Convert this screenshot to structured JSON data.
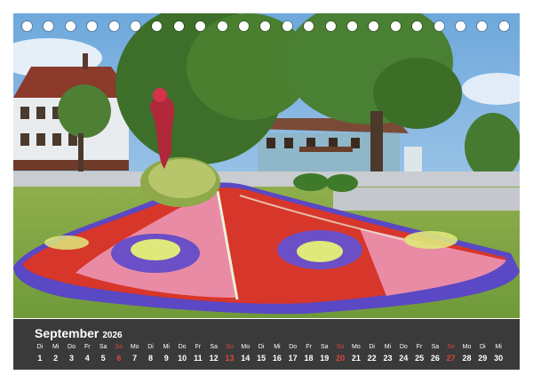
{
  "calendar": {
    "month": "September",
    "year": "2026",
    "days": [
      {
        "wd": "Di",
        "d": "1"
      },
      {
        "wd": "Mi",
        "d": "2"
      },
      {
        "wd": "Do",
        "d": "3"
      },
      {
        "wd": "Fr",
        "d": "4"
      },
      {
        "wd": "Sa",
        "d": "5"
      },
      {
        "wd": "So",
        "d": "6",
        "sun": true
      },
      {
        "wd": "Mo",
        "d": "7"
      },
      {
        "wd": "Di",
        "d": "8"
      },
      {
        "wd": "Mi",
        "d": "9"
      },
      {
        "wd": "Do",
        "d": "10"
      },
      {
        "wd": "Fr",
        "d": "11"
      },
      {
        "wd": "Sa",
        "d": "12"
      },
      {
        "wd": "So",
        "d": "13",
        "sun": true
      },
      {
        "wd": "Mo",
        "d": "14"
      },
      {
        "wd": "Di",
        "d": "15"
      },
      {
        "wd": "Mi",
        "d": "16"
      },
      {
        "wd": "Do",
        "d": "17"
      },
      {
        "wd": "Fr",
        "d": "18"
      },
      {
        "wd": "Sa",
        "d": "19"
      },
      {
        "wd": "So",
        "d": "20",
        "sun": true
      },
      {
        "wd": "Mo",
        "d": "21"
      },
      {
        "wd": "Di",
        "d": "22"
      },
      {
        "wd": "Mi",
        "d": "23"
      },
      {
        "wd": "Do",
        "d": "24"
      },
      {
        "wd": "Fr",
        "d": "25"
      },
      {
        "wd": "Sa",
        "d": "26"
      },
      {
        "wd": "So",
        "d": "27",
        "sun": true
      },
      {
        "wd": "Mo",
        "d": "28"
      },
      {
        "wd": "Di",
        "d": "29"
      },
      {
        "wd": "Mi",
        "d": "30"
      }
    ],
    "sunday_color": "#e0463c",
    "bar_color": "#3a3a3a"
  },
  "photo": {
    "subject": "peacock flower bed in front of a village house",
    "palette": [
      "#d83a2c",
      "#e7809e",
      "#6a4fc7",
      "#dfe87a",
      "#4f8f2f",
      "#8ab8e0"
    ]
  }
}
